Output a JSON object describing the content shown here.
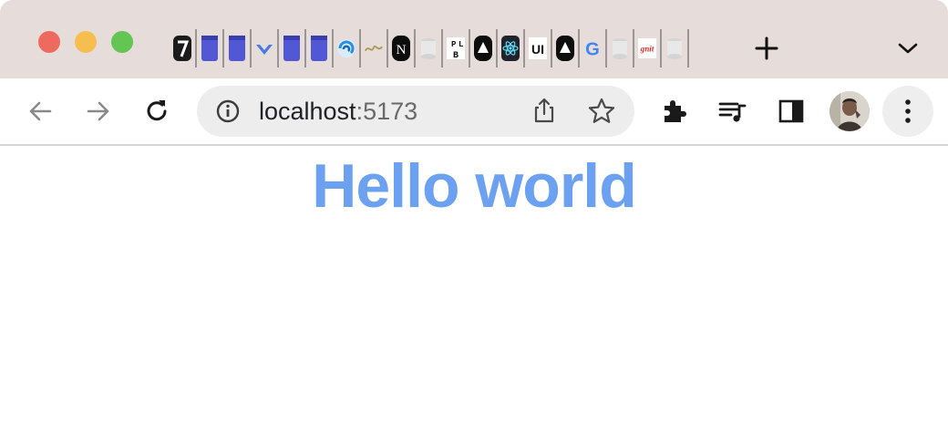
{
  "browser": {
    "window_controls": [
      "close",
      "minimize",
      "zoom"
    ],
    "pinned_tabs": [
      {
        "icon": "seven-logo-icon",
        "label": "7"
      },
      {
        "icon": "indigo-bookmark-icon",
        "label": ""
      },
      {
        "icon": "indigo-bookmark-icon",
        "label": ""
      },
      {
        "icon": "blue-chevron-icon",
        "label": ""
      },
      {
        "icon": "indigo-bookmark-icon",
        "label": ""
      },
      {
        "icon": "indigo-bookmark-icon",
        "label": ""
      },
      {
        "icon": "blue-swirl-icon",
        "label": ""
      },
      {
        "icon": "olive-script-logo-icon",
        "label": ""
      },
      {
        "icon": "n-logo-icon",
        "label": "N"
      },
      {
        "icon": "gray-database-icon",
        "label": ""
      },
      {
        "icon": "plb-logo-icon",
        "label": "P L B"
      },
      {
        "icon": "triangle-logo-icon",
        "label": ""
      },
      {
        "icon": "react-logo-icon",
        "label": ""
      },
      {
        "icon": "ui-logo-icon",
        "label": "UI"
      },
      {
        "icon": "triangle-logo-icon",
        "label": ""
      },
      {
        "icon": "google-g-icon",
        "label": "G"
      },
      {
        "icon": "gray-database-icon",
        "label": ""
      },
      {
        "icon": "red-script-logo-icon",
        "label": "gnit"
      },
      {
        "icon": "gray-database-icon",
        "label": ""
      }
    ],
    "new_tab_icon": "plus-icon",
    "tab_search_icon": "chevron-down-icon",
    "url": {
      "host": "localhost",
      "port": ":5173"
    },
    "colors": {
      "tabstrip": "#e6dcd9",
      "omnibox": "#ededed",
      "accent_heading": "#6ba1f0"
    }
  },
  "page": {
    "heading": "Hello world"
  }
}
